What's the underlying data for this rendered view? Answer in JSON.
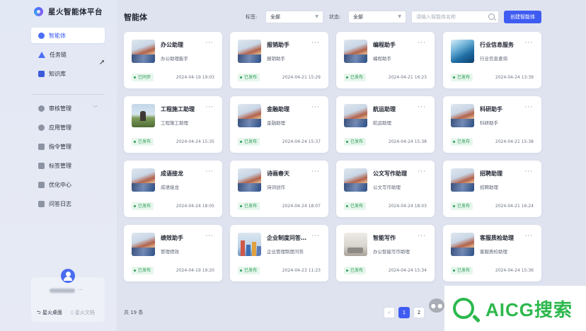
{
  "app": {
    "title": "星火智能体平台"
  },
  "sidebar": {
    "items": [
      {
        "label": "智能体",
        "icon": "agent-icon",
        "active": true
      },
      {
        "label": "任务链",
        "icon": "chain-icon"
      },
      {
        "label": "知识库",
        "icon": "book-icon"
      }
    ],
    "admin_items": [
      {
        "label": "审核管理",
        "icon": "audit-icon",
        "expandable": true
      },
      {
        "label": "应用管理",
        "icon": "app-icon"
      },
      {
        "label": "指令管理",
        "icon": "command-icon"
      },
      {
        "label": "标签管理",
        "icon": "tag-icon"
      },
      {
        "label": "优化中心",
        "icon": "optimize-icon"
      },
      {
        "label": "问答日志",
        "icon": "log-icon"
      }
    ],
    "user": {
      "more": "···",
      "link_desktop": "星火桌面",
      "link_docs": "星火文档"
    }
  },
  "main": {
    "title": "智能体",
    "filters": {
      "tag_label": "标签:",
      "tag_value": "全部",
      "status_label": "状态:",
      "status_value": "全部",
      "search_placeholder": "请输入智能体名称",
      "create_label": "创建智能体"
    },
    "cards": [
      {
        "name": "办公助理",
        "desc": "办公助理能手",
        "status": "已同步",
        "time": "2024-04-19 19:03",
        "thumb": "city"
      },
      {
        "name": "报销助手",
        "desc": "报销助手",
        "status": "已发布",
        "time": "2024-04-21 15:29",
        "thumb": "city"
      },
      {
        "name": "编程助手",
        "desc": "编程助手",
        "status": "已发布",
        "time": "2024-04-21 16:23",
        "thumb": "city"
      },
      {
        "name": "行业信息服务",
        "desc": "行业信息查询",
        "status": "已发布",
        "time": "2024-04-24 13:39",
        "thumb": "wave"
      },
      {
        "name": "工程施工助理",
        "desc": "工程施工助理",
        "status": "已发布",
        "time": "2024-04-24 15:35",
        "thumb": "field"
      },
      {
        "name": "金融助理",
        "desc": "金融助理",
        "status": "已发布",
        "time": "2024-04-24 15:37",
        "thumb": "city"
      },
      {
        "name": "航运助理",
        "desc": "航运助理",
        "status": "已发布",
        "time": "2024-04-24 15:38",
        "thumb": "city"
      },
      {
        "name": "科研助手",
        "desc": "科研助手",
        "status": "已发布",
        "time": "2024-04-21 15:38",
        "thumb": "city"
      },
      {
        "name": "成语接龙",
        "desc": "成语接龙",
        "status": "已发布",
        "time": "2024-04-24 18:05",
        "thumb": "city"
      },
      {
        "name": "诗画春天",
        "desc": "诗词创作",
        "status": "已发布",
        "time": "2024-04-24 18:07",
        "thumb": "city"
      },
      {
        "name": "公文写作助理",
        "desc": "公文写作助理",
        "status": "已发布",
        "time": "2024-04-24 18:03",
        "thumb": "city"
      },
      {
        "name": "招聘助理",
        "desc": "招聘助理",
        "status": "已发布",
        "time": "2024-04-21 16:24",
        "thumb": "city"
      },
      {
        "name": "绩效助手",
        "desc": "管理绩效",
        "status": "已发布",
        "time": "2024-04-19 19:20",
        "thumb": "city"
      },
      {
        "name": "企业制度问答…",
        "desc": "企业管理制度问答",
        "status": "已发布",
        "time": "2024-04-23 11:23",
        "thumb": "tower"
      },
      {
        "name": "智能写作",
        "desc": "办公智能写作助理",
        "status": "已发布",
        "time": "2024-04-24 15:34",
        "thumb": "room"
      },
      {
        "name": "客服质检助理",
        "desc": "客服质检助理",
        "status": "已发布",
        "time": "2024-04-24 15:36",
        "thumb": "city"
      }
    ],
    "card_more": "···",
    "total": "共 19 条",
    "pagination": {
      "prev": "<",
      "pages": [
        "1",
        "2"
      ],
      "current": "1"
    }
  },
  "watermark": {
    "text": "AICG搜索"
  },
  "colors": {
    "accent": "#3f5cf2",
    "published": "#2f9e58",
    "watermark": "#2db84d"
  }
}
